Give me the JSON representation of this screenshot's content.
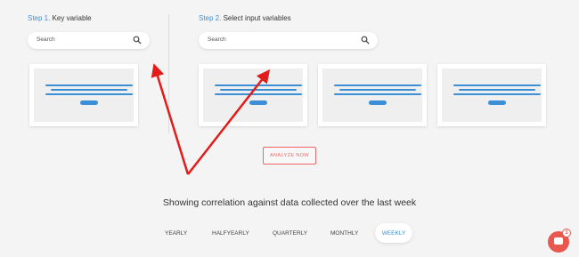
{
  "step1": {
    "num": "Step 1.",
    "label": "Key variable",
    "search_placeholder": "Search"
  },
  "step2": {
    "num": "Step 2.",
    "label": "Select input variables",
    "search_placeholder": "Search"
  },
  "analyze_label": "ANALYZE NOW",
  "heading": "Showing correlation against data collected over the last week",
  "tabs": [
    "YEARLY",
    "HALFYEARLY",
    "QUARTERLY",
    "MONTHLY",
    "WEEKLY"
  ],
  "active_tab": "WEEKLY",
  "chat": {
    "badge": "1"
  },
  "colors": {
    "accent": "#3b8fd6",
    "analyze": "#e66666",
    "annotation_arrow": "#e21b1b",
    "chat": "#e8584f"
  }
}
